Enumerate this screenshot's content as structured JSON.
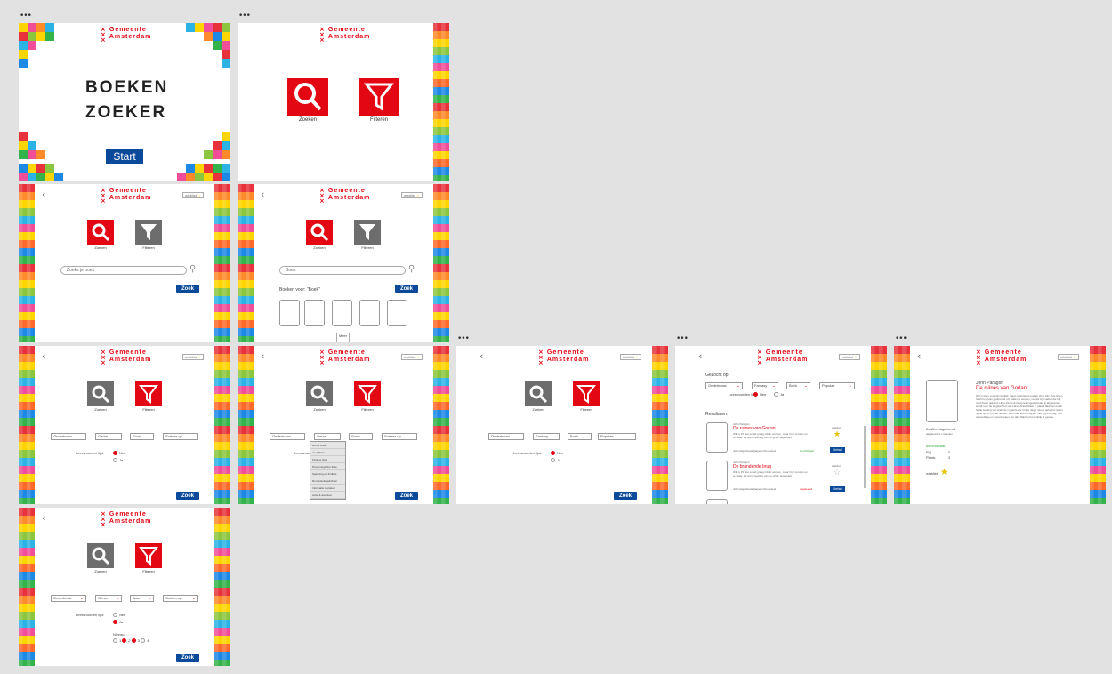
{
  "logo": {
    "line1": "Gemeente",
    "line2": "Amsterdam"
  },
  "dots": "•••",
  "back": "‹",
  "wishlist": "wishlist",
  "app_title_line1": "BOEKEN",
  "app_title_line2": "ZOEKER",
  "start_label": "Start",
  "tiles": {
    "search": "Zoeken",
    "filter": "Filteren"
  },
  "search": {
    "placeholder": "Zoeks je boek",
    "value": "Boek"
  },
  "search_button": "Zoek",
  "books_for": "Boeken voor: \"Boek\"",
  "more": "Meer",
  "filters": {
    "subject": "Onderbouw",
    "genre": "Genre",
    "type": "Soort",
    "sort": "Sorteer op",
    "genre_selected": "Fantasy",
    "type_selected": "Boek",
    "sort_selected": "Populair"
  },
  "reading_list": {
    "label": "Leeswoorden lijst:",
    "no": "Nee",
    "yes": "Ja"
  },
  "level_label": "Niveau:",
  "levels": [
    "1",
    "2",
    "3",
    "4"
  ],
  "genre_options": [
    "Horror Adult",
    "Jeugdfictie",
    "Fictieve fictie",
    "Psychologische fictie",
    "Spanning en thrillers",
    "Romantiek/gedichten",
    "Informatie literatuur",
    "Actie & avontuur"
  ],
  "results": {
    "searched_for": "Gezocht op:",
    "results_label": "Resultaten:",
    "author": "John Paragon",
    "items": [
      {
        "title": "De ruïnes van Gorlan",
        "status": "beschikbaar",
        "status_color": "#3aa845",
        "wish": "wishlist",
        "detail": "Detail"
      },
      {
        "title": "De brandende brug",
        "status": "uitgeleend",
        "status_color": "#e30613",
        "wish": "wishlist",
        "detail": "Detail"
      }
    ],
    "snippet": "Will is 15 jaar en wil graag ridder worden, maar hij is te klein en te zwak. Hij wordt leerling van de grijze jager Halt.",
    "meta": "John.dagenbeekdpaperm/Grootdeel"
  },
  "detail": {
    "author": "John Paragon",
    "title": "De ruïnes van Gorlan",
    "description": "Will is klein voor zijn leeftijd, maar ontzettend snel en slim. Zijn hele leven heeft hij ervan gedroomd om ridder te worden, net als zijn vader, die hij nooit heeft gekend. Hij is dan ook hevig teleurgesteld als hij afgewezen wordt voor de krijgsschool van baron Arald. Maar in plaats daarvan wordt hij de leerling van Halt, de mysterieuze Grijze Jager wiens geheime taken hij nu op zich moet nemen. Will moet leren omgaan met pijl en boog, met camouflage en spoorzoeken. En dan blijkt het koninkrijk in gevaar.",
    "copies": "2x/Wrx uitgeleend",
    "copies_sub": "afgekeurd: 1 maanden",
    "available": "beschikbaar",
    "rij_label": "Rij:",
    "rij": "0",
    "plank_label": "Plank:",
    "plank": "3",
    "wish": "wishlist"
  }
}
